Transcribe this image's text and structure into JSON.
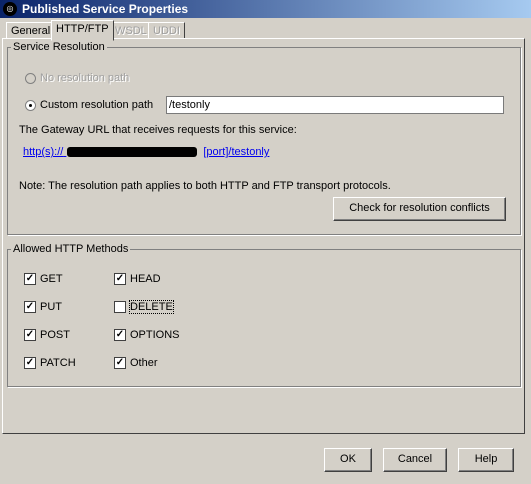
{
  "window": {
    "title": "Published Service Properties",
    "icon": "app-icon"
  },
  "tabs": [
    {
      "label": "General",
      "state": "normal"
    },
    {
      "label": "HTTP/FTP",
      "state": "active"
    },
    {
      "label": "WSDL",
      "state": "disabled"
    },
    {
      "label": "UDDI",
      "state": "disabled"
    }
  ],
  "service_resolution": {
    "legend": "Service Resolution",
    "no_path_label": "No resolution path",
    "custom_label": "Custom resolution path",
    "custom_value": "/testonly",
    "gateway_text": "The Gateway URL that receives requests for this service:",
    "url_prefix": "http(s)://",
    "url_suffix": "[port]/testonly",
    "note": "Note: The resolution path applies to both HTTP and FTP transport protocols.",
    "check_button": "Check for resolution conflicts"
  },
  "methods": {
    "legend": "Allowed HTTP Methods",
    "items": [
      {
        "label": "GET",
        "checked": true
      },
      {
        "label": "HEAD",
        "checked": true
      },
      {
        "label": "PUT",
        "checked": true
      },
      {
        "label": "DELETE",
        "checked": false
      },
      {
        "label": "POST",
        "checked": true
      },
      {
        "label": "OPTIONS",
        "checked": true
      },
      {
        "label": "PATCH",
        "checked": true
      },
      {
        "label": "Other",
        "checked": true
      }
    ]
  },
  "buttons": {
    "ok": "OK",
    "cancel": "Cancel",
    "help": "Help"
  },
  "colors": {
    "title_bar": "#0a246a",
    "link": "#0000ee"
  }
}
